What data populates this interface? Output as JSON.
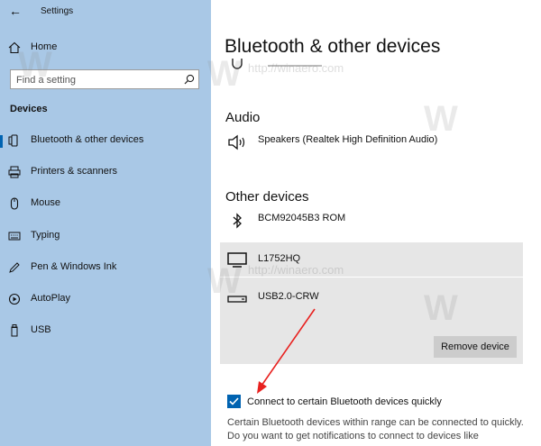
{
  "window": {
    "title": "Settings"
  },
  "sidebar": {
    "home_label": "Home",
    "search_placeholder": "Find a setting",
    "section_heading": "Devices",
    "items": [
      {
        "label": "Bluetooth & other devices",
        "icon": "bluetooth-devices-icon",
        "selected": true
      },
      {
        "label": "Printers & scanners",
        "icon": "printer-icon"
      },
      {
        "label": "Mouse",
        "icon": "mouse-icon"
      },
      {
        "label": "Typing",
        "icon": "keyboard-icon"
      },
      {
        "label": "Pen & Windows Ink",
        "icon": "pen-icon"
      },
      {
        "label": "AutoPlay",
        "icon": "autoplay-icon"
      },
      {
        "label": "USB",
        "icon": "usb-icon"
      }
    ]
  },
  "main": {
    "title": "Bluetooth & other devices",
    "audio_heading": "Audio",
    "audio_devices": [
      {
        "name": "Speakers (Realtek High Definition Audio)",
        "icon": "speaker-icon"
      }
    ],
    "other_heading": "Other devices",
    "other_devices": [
      {
        "name": "BCM92045B3 ROM",
        "icon": "bluetooth-icon"
      },
      {
        "name": "L1752HQ",
        "icon": "monitor-icon"
      },
      {
        "name": "USB2.0-CRW",
        "icon": "usb-drive-icon"
      }
    ],
    "remove_button": "Remove device",
    "quick_connect": {
      "checked": true,
      "label": "Connect to certain Bluetooth devices quickly",
      "description": "Certain Bluetooth devices within range can be connected to quickly. Do you want to get notifications to connect to devices like"
    }
  },
  "watermark": "http://winaero.com",
  "colors": {
    "sidebar_bg": "#a9c8e6",
    "accent": "#0063b1",
    "selected_row": "#e6e6e6",
    "arrow": "#e8211f"
  }
}
